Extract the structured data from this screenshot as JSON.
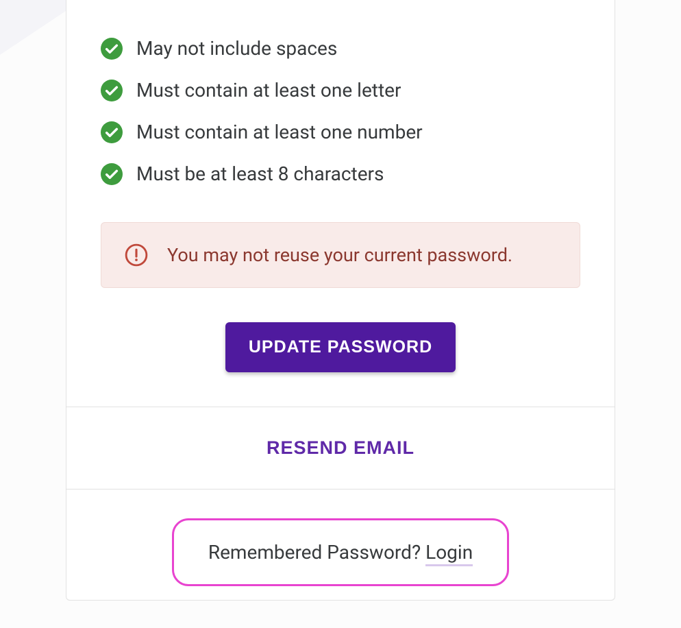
{
  "requirements": [
    {
      "label": "May not include spaces"
    },
    {
      "label": "Must contain at least one letter"
    },
    {
      "label": "Must contain at least one number"
    },
    {
      "label": "Must be at least 8 characters"
    }
  ],
  "alert": {
    "message": "You may not reuse your current password."
  },
  "buttons": {
    "update_password": "UPDATE PASSWORD",
    "resend_email": "RESEND EMAIL"
  },
  "footer": {
    "prompt": "Remembered Password? ",
    "login_link": "Login"
  },
  "colors": {
    "primary": "#4f1a9e",
    "success": "#3e9c3e",
    "error": "#c0392b",
    "highlight": "#e844d0"
  }
}
